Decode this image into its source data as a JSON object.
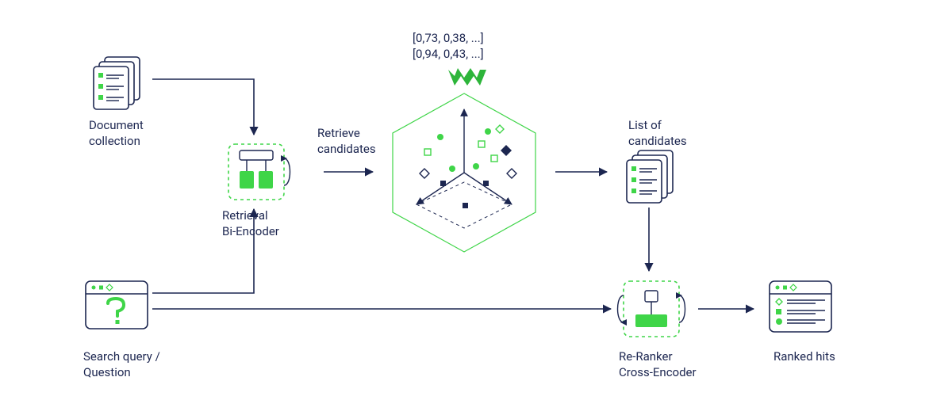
{
  "labels": {
    "document_collection": "Document\ncollection",
    "retrieval_bi_encoder": "Retrieval\nBi-Encoder",
    "retrieve_candidates": "Retrieve\ncandidates",
    "search_query": "Search query /\nQuestion",
    "list_of_candidates": "List of\ncandidates",
    "re_ranker": "Re-Ranker\nCross-Encoder",
    "ranked_hits": "Ranked hits",
    "vec1": "[0,73, 0,38, ...]",
    "vec2": "[0,94, 0,43, ...]"
  },
  "colors": {
    "ink": "#1c2650",
    "green": "#3fd548",
    "greenDark": "#2db53a",
    "lightGreen": "#b7f1bb"
  }
}
